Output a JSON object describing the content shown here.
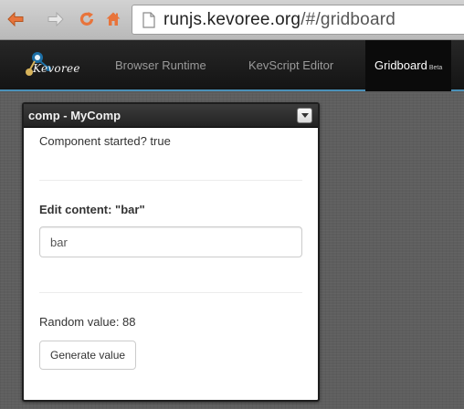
{
  "browser": {
    "url_host": "runjs.kevoree.org",
    "url_path": "/#/gridboard",
    "buttons": {
      "back_icon": "back-arrow-icon",
      "forward_icon": "forward-arrow-icon",
      "reload_icon": "reload-icon",
      "home_icon": "home-icon"
    },
    "accent_color": "#e8743b"
  },
  "app_nav": {
    "logo_text": "Kevoree",
    "items": [
      {
        "label": "Browser Runtime",
        "active": false
      },
      {
        "label": "KevScript Editor",
        "active": false
      },
      {
        "label": "Gridboard",
        "badge": "Beta",
        "active": true
      }
    ],
    "underline_color": "#4a90b8"
  },
  "widget": {
    "title": "comp - MyComp",
    "status_text": "Component started? true",
    "edit_label": "Edit content: \"bar\"",
    "input_value": "bar",
    "random_text": "Random value: 88",
    "button_label": "Generate value"
  }
}
